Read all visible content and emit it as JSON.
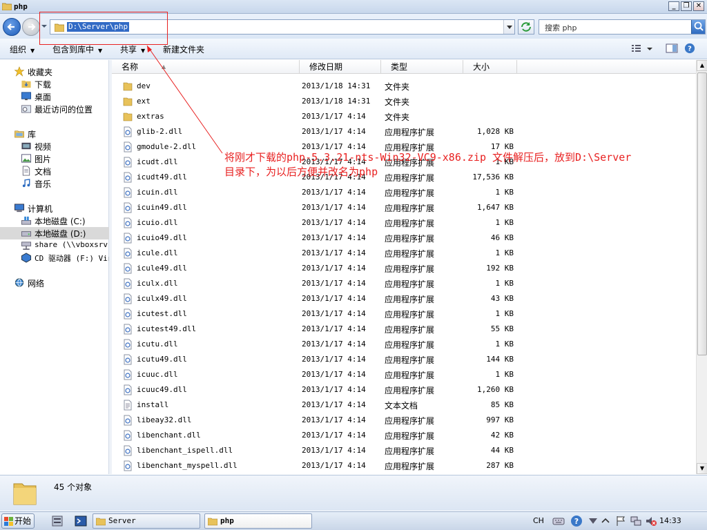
{
  "window": {
    "title": "php"
  },
  "address": {
    "path": "D:\\Server\\php"
  },
  "search": {
    "placeholder": "搜索 php"
  },
  "toolbar": {
    "organize": "组织",
    "include_in_library": "包含到库中",
    "share": "共享",
    "new_folder": "新建文件夹"
  },
  "nav": {
    "favorites": "收藏夹",
    "downloads": "下载",
    "desktop": "桌面",
    "recent": "最近访问的位置",
    "libraries": "库",
    "videos": "视频",
    "pictures": "图片",
    "documents": "文档",
    "music": "音乐",
    "computer": "计算机",
    "drive_c": "本地磁盘 (C:)",
    "drive_d": "本地磁盘 (D:)",
    "share": "share (\\\\vboxsrv)",
    "cd_drive": "CD 驱动器 (F:) Vir",
    "network": "网络"
  },
  "columns": {
    "name": "名称",
    "date": "修改日期",
    "type": "类型",
    "size": "大小"
  },
  "files": [
    {
      "name": "dev",
      "date": "2013/1/18 14:31",
      "type": "文件夹",
      "size": "",
      "icon": "folder"
    },
    {
      "name": "ext",
      "date": "2013/1/18 14:31",
      "type": "文件夹",
      "size": "",
      "icon": "folder"
    },
    {
      "name": "extras",
      "date": "2013/1/17 4:14",
      "type": "文件夹",
      "size": "",
      "icon": "folder"
    },
    {
      "name": "glib-2.dll",
      "date": "2013/1/17 4:14",
      "type": "应用程序扩展",
      "size": "1,028 KB",
      "icon": "dll"
    },
    {
      "name": "gmodule-2.dll",
      "date": "2013/1/17 4:14",
      "type": "应用程序扩展",
      "size": "17 KB",
      "icon": "dll"
    },
    {
      "name": "icudt.dll",
      "date": "2013/1/17 4:14",
      "type": "应用程序扩展",
      "size": "1 KB",
      "icon": "dll"
    },
    {
      "name": "icudt49.dll",
      "date": "2013/1/17 4:14",
      "type": "应用程序扩展",
      "size": "17,536 KB",
      "icon": "dll"
    },
    {
      "name": "icuin.dll",
      "date": "2013/1/17 4:14",
      "type": "应用程序扩展",
      "size": "1 KB",
      "icon": "dll"
    },
    {
      "name": "icuin49.dll",
      "date": "2013/1/17 4:14",
      "type": "应用程序扩展",
      "size": "1,647 KB",
      "icon": "dll"
    },
    {
      "name": "icuio.dll",
      "date": "2013/1/17 4:14",
      "type": "应用程序扩展",
      "size": "1 KB",
      "icon": "dll"
    },
    {
      "name": "icuio49.dll",
      "date": "2013/1/17 4:14",
      "type": "应用程序扩展",
      "size": "46 KB",
      "icon": "dll"
    },
    {
      "name": "icule.dll",
      "date": "2013/1/17 4:14",
      "type": "应用程序扩展",
      "size": "1 KB",
      "icon": "dll"
    },
    {
      "name": "icule49.dll",
      "date": "2013/1/17 4:14",
      "type": "应用程序扩展",
      "size": "192 KB",
      "icon": "dll"
    },
    {
      "name": "iculx.dll",
      "date": "2013/1/17 4:14",
      "type": "应用程序扩展",
      "size": "1 KB",
      "icon": "dll"
    },
    {
      "name": "iculx49.dll",
      "date": "2013/1/17 4:14",
      "type": "应用程序扩展",
      "size": "43 KB",
      "icon": "dll"
    },
    {
      "name": "icutest.dll",
      "date": "2013/1/17 4:14",
      "type": "应用程序扩展",
      "size": "1 KB",
      "icon": "dll"
    },
    {
      "name": "icutest49.dll",
      "date": "2013/1/17 4:14",
      "type": "应用程序扩展",
      "size": "55 KB",
      "icon": "dll"
    },
    {
      "name": "icutu.dll",
      "date": "2013/1/17 4:14",
      "type": "应用程序扩展",
      "size": "1 KB",
      "icon": "dll"
    },
    {
      "name": "icutu49.dll",
      "date": "2013/1/17 4:14",
      "type": "应用程序扩展",
      "size": "144 KB",
      "icon": "dll"
    },
    {
      "name": "icuuc.dll",
      "date": "2013/1/17 4:14",
      "type": "应用程序扩展",
      "size": "1 KB",
      "icon": "dll"
    },
    {
      "name": "icuuc49.dll",
      "date": "2013/1/17 4:14",
      "type": "应用程序扩展",
      "size": "1,260 KB",
      "icon": "dll"
    },
    {
      "name": "install",
      "date": "2013/1/17 4:14",
      "type": "文本文档",
      "size": "85 KB",
      "icon": "txt"
    },
    {
      "name": "libeay32.dll",
      "date": "2013/1/17 4:14",
      "type": "应用程序扩展",
      "size": "997 KB",
      "icon": "dll"
    },
    {
      "name": "libenchant.dll",
      "date": "2013/1/17 4:14",
      "type": "应用程序扩展",
      "size": "42 KB",
      "icon": "dll"
    },
    {
      "name": "libenchant_ispell.dll",
      "date": "2013/1/17 4:14",
      "type": "应用程序扩展",
      "size": "44 KB",
      "icon": "dll"
    },
    {
      "name": "libenchant_myspell.dll",
      "date": "2013/1/17 4:14",
      "type": "应用程序扩展",
      "size": "287 KB",
      "icon": "dll"
    }
  ],
  "status": {
    "count": "45 个对象"
  },
  "annotation": {
    "line1": "将刚才下载的php-5.3.21-nts-Win32-VC9-x86.zip 文件解压后，放到D:\\Server",
    "line2": "目录下，为以后方便并改名为php",
    "color": "#e82020"
  },
  "taskbar": {
    "start": "开始",
    "tasks": [
      {
        "label": "Server",
        "active": false
      },
      {
        "label": "php",
        "active": true
      }
    ],
    "ime": "CH",
    "clock": "14:33"
  }
}
